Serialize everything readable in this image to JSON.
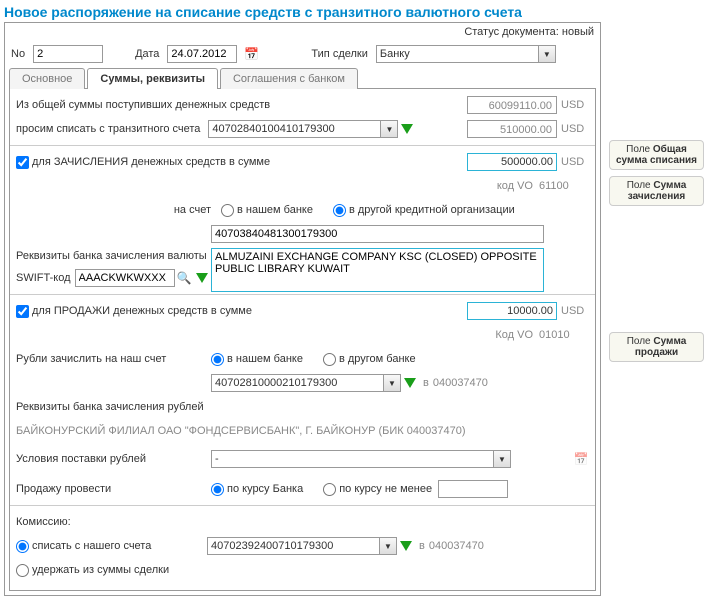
{
  "title": "Новое распоряжение на списание средств с транзитного валютного счета",
  "status_label": "Статус документа:",
  "status_value": "новый",
  "header": {
    "no_label": "No",
    "no_value": "2",
    "date_label": "Дата",
    "date_value": "24.07.2012",
    "deal_label": "Тип сделки",
    "deal_value": "Банку"
  },
  "tabs": {
    "t1": "Основное",
    "t2": "Суммы, реквизиты",
    "t3": "Соглашения с банком"
  },
  "section1": {
    "row1_label": "Из общей суммы поступивших денежных средств",
    "row1_amount": "60099110.00",
    "row2_label": "просим списать с транзитного счета",
    "row2_account": "40702840100410179300",
    "row2_amount": "510000.00",
    "ccy": "USD"
  },
  "section2": {
    "chk_label": "для ЗАЧИСЛЕНИЯ денежных средств в сумме",
    "amount": "500000.00",
    "ccy": "USD",
    "vo_label": "код VO",
    "vo_value": "61100",
    "to_account_label": "на счет",
    "radio1": "в нашем банке",
    "radio2": "в другой кредитной организации",
    "account": "40703840481300179300",
    "bank_details_label": "Реквизиты банка зачисления валюты",
    "bank_details": "ALMUZAINI EXCHANGE COMPANY KSC (CLOSED) OPPOSITE PUBLIC LIBRARY KUWAIT",
    "swift_label": "SWIFT-код",
    "swift_value": "AAACKWKWXXX"
  },
  "section3": {
    "chk_label": "для ПРОДАЖИ денежных средств в сумме",
    "amount": "10000.00",
    "ccy": "USD",
    "vo_label": "Код VO",
    "vo_value": "01010",
    "rubles_label": "Рубли зачислить на наш счет",
    "radio1": "в нашем банке",
    "radio2": "в другом банке",
    "account": "40702810000210179300",
    "in_label": "в",
    "in_value": "040037470",
    "bank_details_label": "Реквизиты банка зачисления рублей",
    "bank_details": "БАЙКОНУРСКИЙ ФИЛИАЛ ОАО \"ФОНДСЕРВИСБАНК\", Г. БАЙКОНУР (БИК 040037470)",
    "delivery_label": "Условия поставки рублей",
    "delivery_value": "-",
    "sell_label": "Продажу провести",
    "sell_radio1": "по курсу Банка",
    "sell_radio2": "по курсу не менее"
  },
  "section4": {
    "commission_label": "Комиссию:",
    "r1": "списать с нашего счета",
    "r2": "удержать из суммы сделки",
    "account": "40702392400710179300",
    "in_label": "в",
    "in_value": "040037470"
  },
  "annot": {
    "a1_pre": "Поле ",
    "a1_b1": "Общая сумма списания",
    "a2_b": "Сумма зачисления",
    "a3_b": "Сумма продажи"
  }
}
